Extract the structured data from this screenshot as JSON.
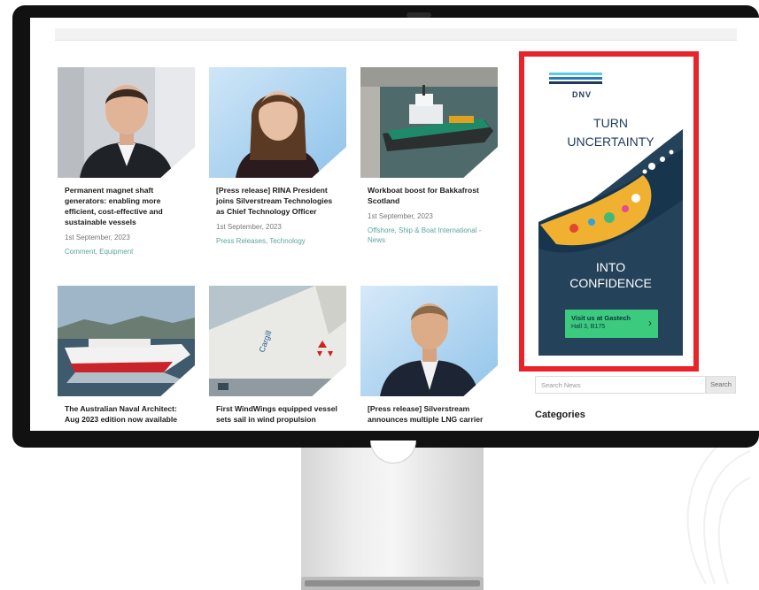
{
  "articles": [
    {
      "title": "Permanent magnet shaft generators: enabling more efficient, cost-effective and sustainable vessels",
      "date": "1st September, 2023",
      "categories": "Comment, Equipment",
      "image_icon": "portrait-photo-man-icon"
    },
    {
      "title": "[Press release] RINA President joins Silverstream Technologies as Chief Technology Officer",
      "date": "1st September, 2023",
      "categories": "Press Releases, Technology",
      "image_icon": "portrait-photo-woman-icon"
    },
    {
      "title": "Workboat boost for Bakkafrost Scotland",
      "date": "1st September, 2023",
      "categories": "Offshore, Ship & Boat International - News",
      "image_icon": "workboat-photo-icon"
    },
    {
      "title": "The Australian Naval Architect: Aug 2023 edition now available",
      "date": "",
      "categories": "",
      "image_icon": "ferry-photo-icon"
    },
    {
      "title": "First WindWings equipped vessel sets sail in wind propulsion",
      "date": "",
      "categories": "",
      "image_icon": "windwings-photo-icon"
    },
    {
      "title": "[Press release] Silverstream announces multiple LNG carrier",
      "date": "",
      "categories": "",
      "image_icon": "portrait-photo-man-suit-icon"
    }
  ],
  "plus_symbol": "+",
  "ad": {
    "brand": "DNV",
    "headline_1": "TURN",
    "headline_2": "UNCERTAINTY",
    "headline_3": "INTO",
    "headline_4": "CONFIDENCE",
    "cta_line_1": "Visit us at Gastech",
    "cta_line_2": "Hall 3, B175",
    "cta_arrow": "›",
    "highlight_color": "#e8232a",
    "cta_color": "#3ccb7e",
    "background_color": "#24425a"
  },
  "sidebar": {
    "search_placeholder": "Search News",
    "search_button": "Search",
    "categories_heading": "Categories"
  }
}
